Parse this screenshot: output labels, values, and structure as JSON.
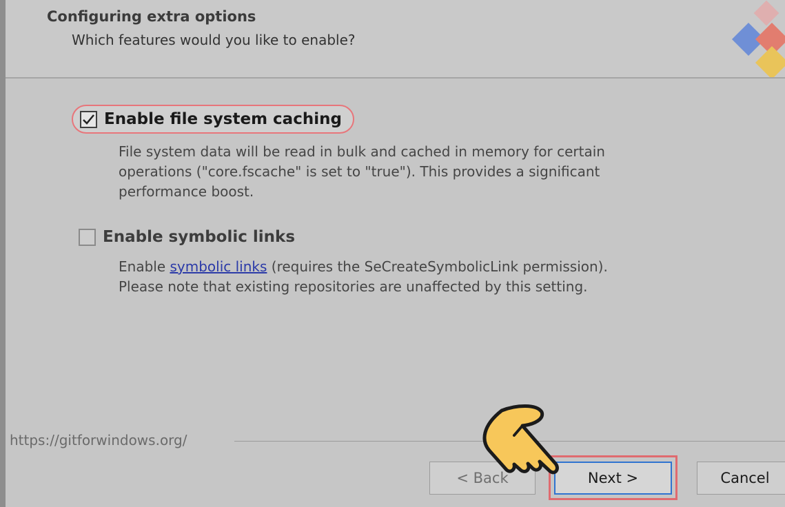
{
  "header": {
    "title": "Configuring extra options",
    "subtitle": "Which features would you like to enable?"
  },
  "options": [
    {
      "label": "Enable file system caching",
      "checked": true,
      "description_lines": [
        "File system data will be read in bulk and cached in memory for certain",
        "operations (\"core.fscache\" is set to \"true\"). This provides a significant",
        "performance boost."
      ]
    },
    {
      "label": "Enable symbolic links",
      "checked": false,
      "description_prefix": "Enable ",
      "description_link": "symbolic links",
      "description_suffix": " (requires the SeCreateSymbolicLink permission).",
      "description_line2": "Please note that existing repositories are unaffected by this setting."
    }
  ],
  "footer": {
    "url": "https://gitforwindows.org/",
    "back_label": "< Back",
    "next_label": "Next >",
    "cancel_label": "Cancel"
  },
  "icons": {
    "checkmark": "checkmark-icon",
    "hand_pointer": "hand-pointer-icon",
    "logo": "git-logo-icon"
  },
  "colors": {
    "highlight": "#e06a6f",
    "focus_border": "#2f73d0",
    "link": "#2b3aa8",
    "hand_fill": "#f7c75a"
  }
}
